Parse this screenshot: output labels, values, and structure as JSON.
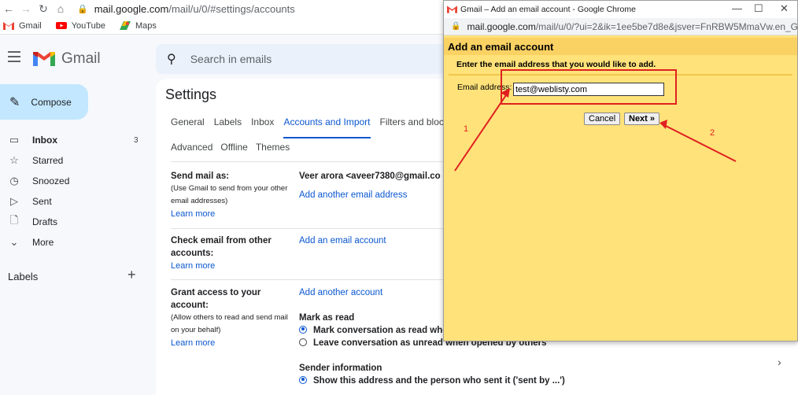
{
  "browser": {
    "url_host": "mail.google.com",
    "url_path": "/mail/u/0/#settings/accounts",
    "bookmarks": [
      {
        "label": "Gmail"
      },
      {
        "label": "YouTube"
      },
      {
        "label": "Maps"
      }
    ]
  },
  "header": {
    "app_name": "Gmail",
    "search_placeholder": "Search in emails"
  },
  "sidebar": {
    "compose": "Compose",
    "items": [
      {
        "label": "Inbox",
        "count": "3",
        "icon": "inbox-icon"
      },
      {
        "label": "Starred",
        "count": "",
        "icon": "star-icon"
      },
      {
        "label": "Snoozed",
        "count": "",
        "icon": "clock-icon"
      },
      {
        "label": "Sent",
        "count": "",
        "icon": "send-icon"
      },
      {
        "label": "Drafts",
        "count": "",
        "icon": "draft-icon"
      },
      {
        "label": "More",
        "count": "",
        "icon": "chevron-down-icon"
      }
    ],
    "labels_heading": "Labels",
    "labels_add": "+"
  },
  "settings": {
    "title": "Settings",
    "tabs": [
      "General",
      "Labels",
      "Inbox",
      "Accounts and Import",
      "Filters and bloc"
    ],
    "tabs_row2": [
      "Advanced",
      "Offline",
      "Themes"
    ],
    "active_tab": "Accounts and Import",
    "send_mail": {
      "label": "Send mail as:",
      "desc": "(Use Gmail to send from your other email addresses)",
      "learn_more": "Learn more",
      "account": "Veer arora <aveer7380@gmail.co",
      "add_link": "Add another email address"
    },
    "check_mail": {
      "label": "Check email from other accounts:",
      "learn_more": "Learn more",
      "add_link": "Add an email account"
    },
    "grant_access": {
      "label": "Grant access to your account:",
      "desc": "(Allow others to read and send mail on your behalf)",
      "learn_more": "Learn more",
      "add_link": "Add another account",
      "mark_as_read_heading": "Mark as read",
      "option1": "Mark conversation as read whe",
      "option2": "Leave conversation as unread when opened by others",
      "sender_info_heading": "Sender information",
      "option3": "Show this address and the person who sent it ('sent by ...')"
    }
  },
  "popup": {
    "window_title": "Gmail – Add an email account - Google Chrome",
    "url_host": "mail.google.com",
    "url_path": "/mail/u/0/?ui=2&ik=1ee5be7d8e&jsver=FnRBW5MmaVw.en_G...",
    "heading": "Add an email account",
    "instruction": "Enter the email address that you would like to add.",
    "field_label": "Email address:",
    "field_value": "test@weblisty.com",
    "cancel": "Cancel",
    "next": "Next »"
  },
  "annotations": {
    "label1": "1",
    "label2": "2",
    "color": "#e02020"
  },
  "colors": {
    "popup_bg": "#ffe27a",
    "popup_header": "#fad163",
    "link": "#0b57d0",
    "compose_bg": "#c2e7ff"
  }
}
